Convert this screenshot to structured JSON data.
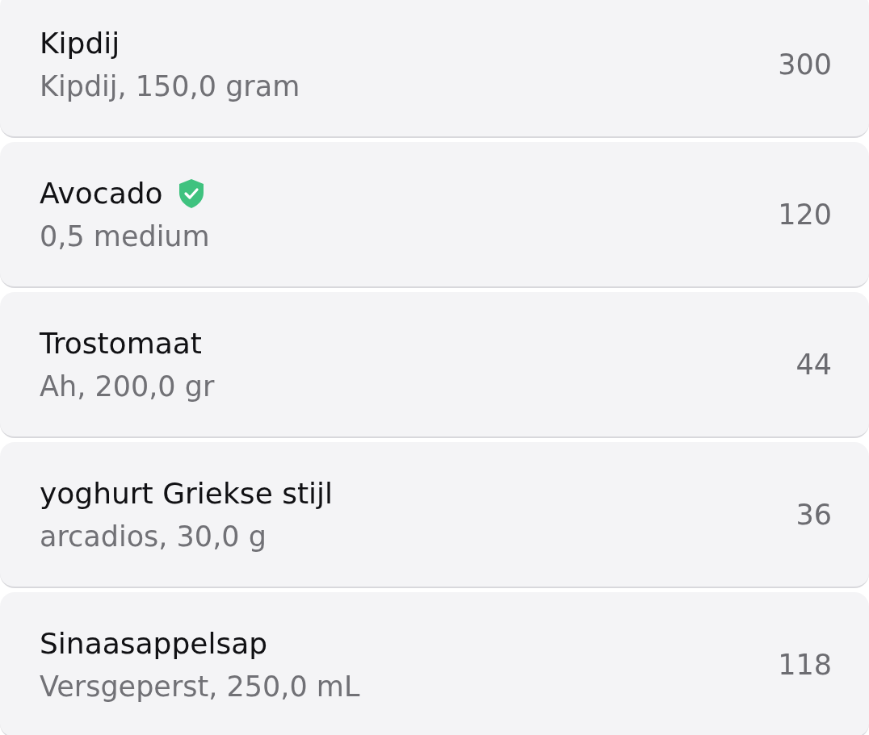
{
  "items": [
    {
      "name": "Kipdij",
      "detail": "Kipdij, 150,0 gram",
      "calories": "300",
      "verified": false
    },
    {
      "name": "Avocado",
      "detail": "0,5 medium",
      "calories": "120",
      "verified": true
    },
    {
      "name": "Trostomaat",
      "detail": "Ah, 200,0 gr",
      "calories": "44",
      "verified": false
    },
    {
      "name": "yoghurt Griekse stijl",
      "detail": "arcadios, 30,0 g",
      "calories": "36",
      "verified": false
    },
    {
      "name": "Sinaasappelsap",
      "detail": "Versgeperst, 250,0 mL",
      "calories": "118",
      "verified": false
    }
  ]
}
